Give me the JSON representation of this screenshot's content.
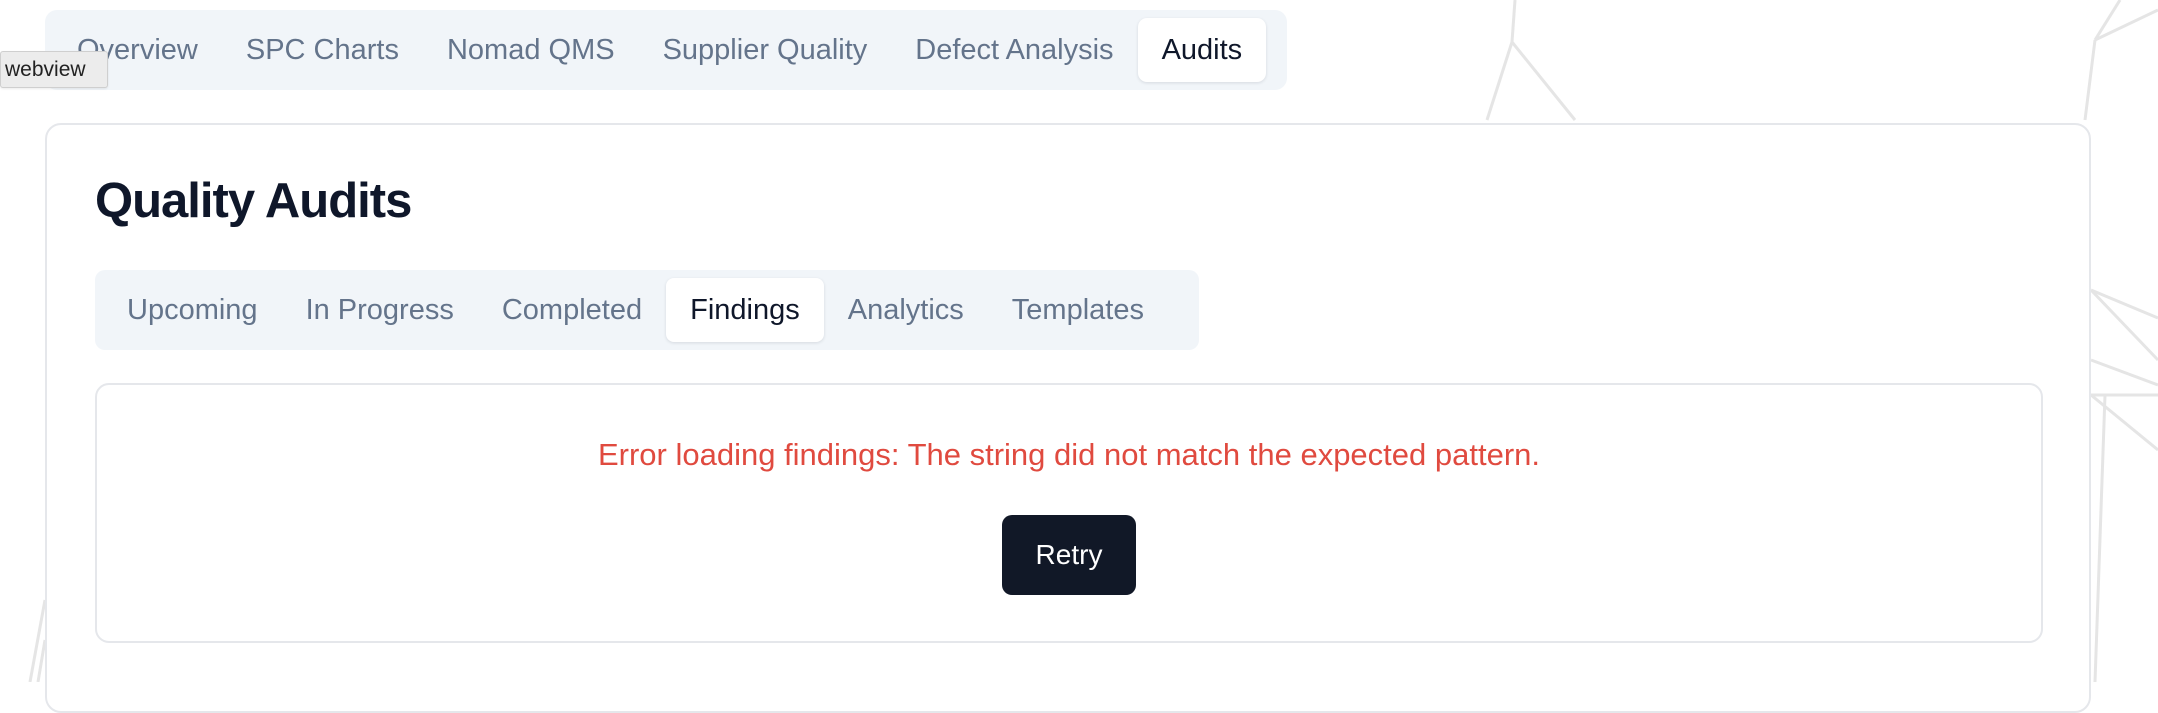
{
  "debug_tag": "webview",
  "top_tabs": [
    {
      "label": "Overview",
      "active": false
    },
    {
      "label": "SPC Charts",
      "active": false
    },
    {
      "label": "Nomad QMS",
      "active": false
    },
    {
      "label": "Supplier Quality",
      "active": false
    },
    {
      "label": "Defect Analysis",
      "active": false
    },
    {
      "label": "Audits",
      "active": true
    }
  ],
  "page": {
    "title": "Quality Audits"
  },
  "sub_tabs": [
    {
      "label": "Upcoming",
      "active": false
    },
    {
      "label": "In Progress",
      "active": false
    },
    {
      "label": "Completed",
      "active": false
    },
    {
      "label": "Findings",
      "active": true
    },
    {
      "label": "Analytics",
      "active": false
    },
    {
      "label": "Templates",
      "active": false
    }
  ],
  "error": {
    "message": "Error loading findings: The string did not match the expected pattern.",
    "retry_label": "Retry"
  },
  "colors": {
    "error_text": "#e04a3f",
    "primary_button": "#111827",
    "tab_bar_background": "#f1f5f9",
    "muted_text": "#64748b"
  }
}
